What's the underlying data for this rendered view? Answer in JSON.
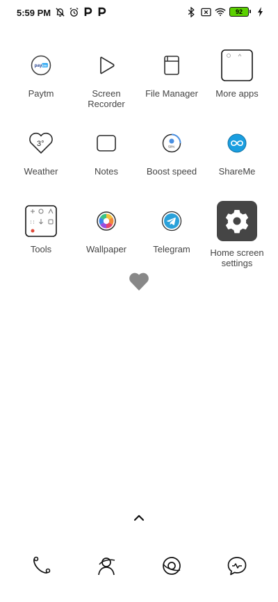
{
  "status_bar": {
    "time": "5:59 PM",
    "battery_level": "92",
    "left_icons": [
      "do-not-disturb-icon",
      "alarm-icon",
      "paytm-notification-icon",
      "paytm-notification-icon"
    ],
    "right_icons": [
      "bluetooth-icon",
      "no-sim-icon",
      "wifi-icon",
      "battery-icon",
      "charging-icon"
    ]
  },
  "apps": [
    {
      "label": "Paytm",
      "icon": "paytm-icon"
    },
    {
      "label": "Screen\nRecorder",
      "icon": "screen-recorder-icon"
    },
    {
      "label": "File Manager",
      "icon": "file-manager-icon"
    },
    {
      "label": "More apps",
      "icon": "folder-icon"
    },
    {
      "label": "Weather",
      "icon": "weather-icon",
      "value": "3°"
    },
    {
      "label": "Notes",
      "icon": "notes-icon"
    },
    {
      "label": "Boost speed",
      "icon": "boost-speed-icon",
      "value": "50%"
    },
    {
      "label": "ShareMe",
      "icon": "shareme-icon"
    },
    {
      "label": "Tools",
      "icon": "tools-icon"
    },
    {
      "label": "Wallpaper",
      "icon": "wallpaper-icon"
    },
    {
      "label": "Telegram",
      "icon": "telegram-icon"
    },
    {
      "label": "Home screen\nsettings",
      "icon": "settings-icon"
    }
  ],
  "dock": [
    "phone-icon",
    "contacts-icon",
    "browser-icon",
    "messages-icon"
  ],
  "colors": {
    "battery": "#5bd100",
    "shareme": "#1a9ee0",
    "telegram": "#2aa1da",
    "settings_tile": "#454545",
    "paytm_blue": "#1c3a8a"
  }
}
